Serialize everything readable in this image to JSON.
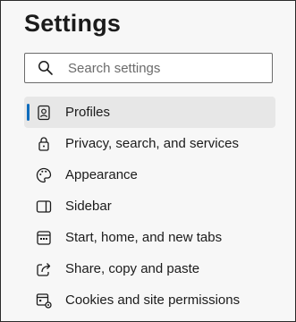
{
  "page": {
    "title": "Settings"
  },
  "search": {
    "placeholder": "Search settings",
    "icon": "search-icon"
  },
  "nav": {
    "items": [
      {
        "label": "Profiles",
        "icon": "profile-icon",
        "selected": true
      },
      {
        "label": "Privacy, search, and services",
        "icon": "lock-icon",
        "selected": false
      },
      {
        "label": "Appearance",
        "icon": "palette-icon",
        "selected": false
      },
      {
        "label": "Sidebar",
        "icon": "sidebar-icon",
        "selected": false
      },
      {
        "label": "Start, home, and new tabs",
        "icon": "home-tabs-icon",
        "selected": false
      },
      {
        "label": "Share, copy and paste",
        "icon": "share-icon",
        "selected": false
      },
      {
        "label": "Cookies and site permissions",
        "icon": "cookies-permissions-icon",
        "selected": false
      }
    ]
  },
  "colors": {
    "accent": "#0f6cbd",
    "selected_bg": "#e7e7e7",
    "panel_bg": "#f7f7f7"
  }
}
